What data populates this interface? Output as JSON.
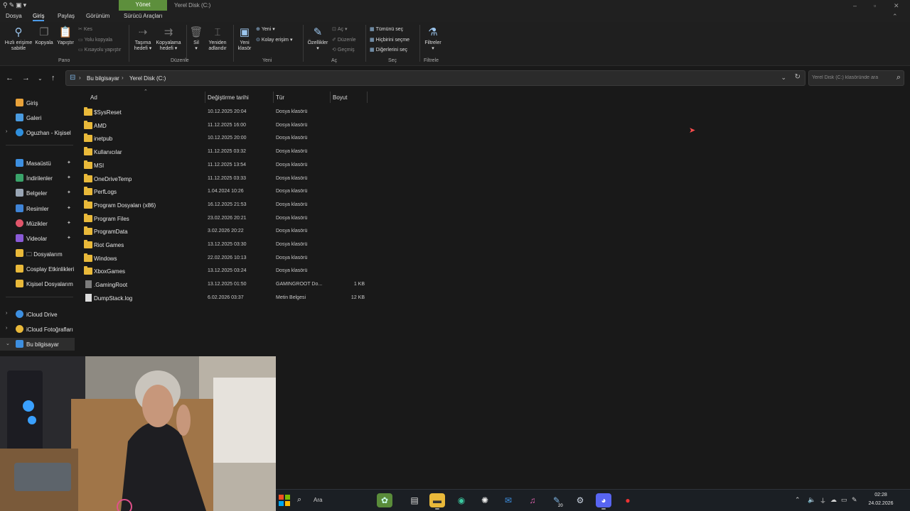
{
  "window": {
    "title": "Yerel Disk (C:)",
    "manage_tab": "Yönet",
    "qat_icons": [
      "pin-icon",
      "properties-icon",
      "new-folder-icon"
    ],
    "controls": {
      "minimize": "–",
      "restore": "▫",
      "close": "✕"
    }
  },
  "menu": {
    "tabs": [
      "Dosya",
      "Giriş",
      "Paylaş",
      "Görünüm",
      "Sürücü Araçları"
    ],
    "active": "Giriş"
  },
  "ribbon": {
    "pano": {
      "group": "Pano",
      "pin_label_1": "Hızlı erişime",
      "pin_label_2": "sabitle",
      "copy": "Kopyala",
      "paste": "Yapıştır",
      "cut": "Kes",
      "copy_path": "Yolu kopyala",
      "paste_shortcut": "Kısayolu yapıştır"
    },
    "duzenle": {
      "group": "Düzenle",
      "move_1": "Taşıma",
      "move_2": "hedefi ▾",
      "copyto_1": "Kopyalama",
      "copyto_2": "hedefi ▾",
      "delete_1": "Sil",
      "delete_2": "▾",
      "rename_1": "Yeniden",
      "rename_2": "adlandır"
    },
    "yeni": {
      "group": "Yeni",
      "newfolder_1": "Yeni",
      "newfolder_2": "klasör",
      "new_item": "Yeni ▾",
      "easy_access": "Kolay erişim ▾"
    },
    "ac": {
      "group": "Aç",
      "properties_1": "Özellikler",
      "properties_2": "▾",
      "open": "Aç ▾",
      "edit": "Düzenle",
      "history": "Geçmiş"
    },
    "sec": {
      "group": "Seç",
      "select_all": "Tümünü seç",
      "select_none": "Hiçbirini seçme",
      "invert": "Diğerlerini seç"
    },
    "filtrele": {
      "group": "Filtrele",
      "filters_1": "Filtreler",
      "filters_2": "▾"
    }
  },
  "address": {
    "crumbs": [
      "Bu bilgisayar",
      "Yerel Disk (C:)"
    ],
    "separator": "›"
  },
  "search": {
    "placeholder": "Yerel Disk (C:) klasöründe ara"
  },
  "sidebar": {
    "items": [
      {
        "label": "Giriş",
        "icon": "home-icon",
        "color": "#e8a23a"
      },
      {
        "label": "Galeri",
        "icon": "gallery-icon",
        "color": "#4a9be0"
      },
      {
        "label": "Oguzhan - Kişisel",
        "icon": "onedrive-icon",
        "color": "#2f8fdc"
      },
      {
        "label": "Masaüstü",
        "icon": "desktop-icon",
        "color": "#3d8fe0"
      },
      {
        "label": "İndirilenler",
        "icon": "download-icon",
        "color": "#3aa36a"
      },
      {
        "label": "Belgeler",
        "icon": "documents-icon",
        "color": "#9aa6b5"
      },
      {
        "label": "Resimler",
        "icon": "pictures-icon",
        "color": "#3f84d6"
      },
      {
        "label": "Müzikler",
        "icon": "music-icon",
        "color": "#e0556a"
      },
      {
        "label": "Videolar",
        "icon": "videos-icon",
        "color": "#8a5ad6"
      },
      {
        "label": "🗀 Dosyalarım",
        "icon": "folder-icon",
        "color": "#e9b93a"
      },
      {
        "label": "Cosplay Etkinlikleri",
        "icon": "folder-icon",
        "color": "#e9b93a"
      },
      {
        "label": "Kişisel Dosyalarım",
        "icon": "folder-icon",
        "color": "#e9b93a"
      },
      {
        "label": "iCloud Drive",
        "icon": "icloud-icon",
        "color": "#3d8fe0"
      },
      {
        "label": "iCloud Fotoğrafları",
        "icon": "icloud-photos-icon",
        "color": "#e9b93a"
      },
      {
        "label": "Bu bilgisayar",
        "icon": "this-pc-icon",
        "color": "#3d8fe0"
      }
    ]
  },
  "columns": {
    "name": "Ad",
    "date": "Değiştirme tarihi",
    "type": "Tür",
    "size": "Boyut"
  },
  "files": [
    {
      "name": "$SysReset",
      "date": "10.12.2025 20:04",
      "type": "Dosya klasörü",
      "size": "",
      "kind": "folder"
    },
    {
      "name": "AMD",
      "date": "11.12.2025 16:00",
      "type": "Dosya klasörü",
      "size": "",
      "kind": "folder"
    },
    {
      "name": "inetpub",
      "date": "10.12.2025 20:00",
      "type": "Dosya klasörü",
      "size": "",
      "kind": "folder"
    },
    {
      "name": "Kullanıcılar",
      "date": "11.12.2025 03:32",
      "type": "Dosya klasörü",
      "size": "",
      "kind": "folder"
    },
    {
      "name": "MSI",
      "date": "11.12.2025 13:54",
      "type": "Dosya klasörü",
      "size": "",
      "kind": "folder"
    },
    {
      "name": "OneDriveTemp",
      "date": "11.12.2025 03:33",
      "type": "Dosya klasörü",
      "size": "",
      "kind": "folder"
    },
    {
      "name": "PerfLogs",
      "date": "1.04.2024 10:26",
      "type": "Dosya klasörü",
      "size": "",
      "kind": "folder"
    },
    {
      "name": "Program Dosyaları (x86)",
      "date": "16.12.2025 21:53",
      "type": "Dosya klasörü",
      "size": "",
      "kind": "folder"
    },
    {
      "name": "Program Files",
      "date": "23.02.2026 20:21",
      "type": "Dosya klasörü",
      "size": "",
      "kind": "folder"
    },
    {
      "name": "ProgramData",
      "date": "3.02.2026 20:22",
      "type": "Dosya klasörü",
      "size": "",
      "kind": "folder"
    },
    {
      "name": "Riot Games",
      "date": "13.12.2025 03:30",
      "type": "Dosya klasörü",
      "size": "",
      "kind": "folder"
    },
    {
      "name": "Windows",
      "date": "22.02.2026 10:13",
      "type": "Dosya klasörü",
      "size": "",
      "kind": "folder"
    },
    {
      "name": "XboxGames",
      "date": "13.12.2025 03:24",
      "type": "Dosya klasörü",
      "size": "",
      "kind": "folder"
    },
    {
      "name": ".GamingRoot",
      "date": "13.12.2025 01:50",
      "type": "GAMINGROOT Do...",
      "size": "1 KB",
      "kind": "plain"
    },
    {
      "name": "DumpStack.log",
      "date": "6.02.2026 03:37",
      "type": "Metin Belgesi",
      "size": "12 KB",
      "kind": "file"
    }
  ],
  "taskbar": {
    "search_label": "Ara",
    "badge": "20",
    "time": "02:28",
    "date": "24.02.2026",
    "apps": [
      "game-app-icon",
      "file-manager-app-icon",
      "file-explorer-icon",
      "edge-icon",
      "chatgpt-icon",
      "mail-icon",
      "itunes-icon",
      "app-with-badge-icon",
      "steam-icon",
      "discord-icon",
      "obs-icon"
    ]
  },
  "colors": {
    "accent": "#4c9be8",
    "manage_tab": "#5d8f3c",
    "folder": "#e9b93a"
  }
}
